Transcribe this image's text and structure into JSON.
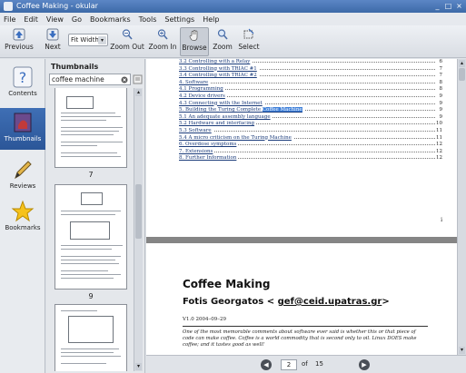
{
  "window": {
    "title": "Coffee Making - okular",
    "controls": [
      "_",
      "□",
      "×"
    ]
  },
  "menu": [
    "File",
    "Edit",
    "View",
    "Go",
    "Bookmarks",
    "Tools",
    "Settings",
    "Help"
  ],
  "toolbar": {
    "previous": "Previous",
    "next": "Next",
    "zoom_value": "Fit Width",
    "zoom_out": "Zoom Out",
    "zoom_in": "Zoom In",
    "browse": "Browse",
    "zoom": "Zoom",
    "select": "Select"
  },
  "sidebar": {
    "contents": "Contents",
    "thumbnails": "Thumbnails",
    "reviews": "Reviews",
    "bookmarks": "Bookmarks"
  },
  "thumbnails": {
    "heading": "Thumbnails",
    "search_value": "coffee machine",
    "page_labels": [
      "7",
      "9"
    ]
  },
  "document": {
    "toc": [
      {
        "text": "3.2 Controlling with a Relay",
        "page": "6"
      },
      {
        "text": "3.3 Controlling with TRIAC #1",
        "page": "7"
      },
      {
        "text": "3.4 Controlling with TRIAC #2",
        "page": "7"
      },
      {
        "text": "4. Software",
        "page": "8"
      },
      {
        "text": "4.1 Programming",
        "page": "8"
      },
      {
        "text": "4.2 Device drivers",
        "page": "9"
      },
      {
        "text": "4.3 Connecting with the Internet",
        "page": "9"
      },
      {
        "text_before": "5. Building the Turing Complete ",
        "highlight": "Coffee Machine",
        "page": "9"
      },
      {
        "text": "5.1 An adequate assembly language",
        "page": "9"
      },
      {
        "text": "5.2 Hardware and interfacing",
        "page": "10"
      },
      {
        "text": "5.3 Software",
        "page": "11"
      },
      {
        "text": "5.4 A micro criticism on the Turing Machine",
        "page": "11"
      },
      {
        "text": "6. Overdose symptoms",
        "page": "12"
      },
      {
        "text": "7. Extensions",
        "page": "12"
      },
      {
        "text": "8. Further Information",
        "page": "12"
      }
    ],
    "page_roman": "i",
    "title": "Coffee Making",
    "author_prefix": "Fotis Georgatos < ",
    "author_email": "gef@ceid.upatras.gr",
    "author_suffix": ">",
    "version": "V1.0  2004–09–29",
    "abstract": "One of the most memorable comments about software ever said is whether this or that piece of code can make coffee. Coffee is a world commodity that is second only to oil. Linux DOES make coffee; and it tastes good as well!"
  },
  "pagebar": {
    "current_page": "2",
    "of_label": "of",
    "total_pages": "15"
  }
}
